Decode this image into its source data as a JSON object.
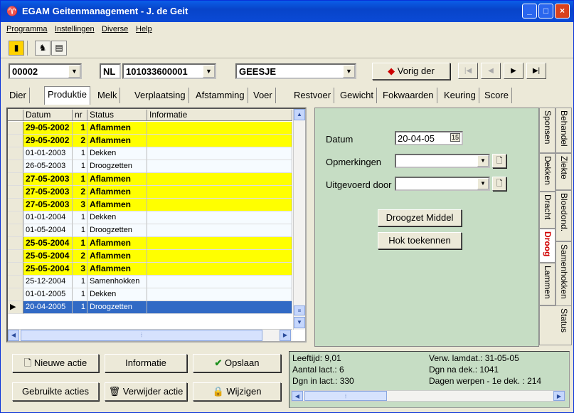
{
  "window": {
    "title": "EGAM Geitenmanagement - J. de Geit",
    "minimize": "_",
    "maximize": "□",
    "close": "×"
  },
  "menu": [
    "Programma",
    "Instellingen",
    "Diverse",
    "Help"
  ],
  "toolbar": {
    "exit_icon": "door-icon",
    "goat_icon": "goat-icon",
    "note_icon": "notepad-icon"
  },
  "selectors": {
    "number": "00002",
    "country": "NL",
    "id": "101033600001",
    "name": "GEESJE"
  },
  "nav": {
    "prev_label": "Vorig der",
    "first": "|◀",
    "prev": "◀",
    "next": "▶",
    "last": "▶|"
  },
  "tabs": [
    "Dier",
    "Produktie",
    "Melk",
    "Verplaatsing",
    "Afstamming",
    "Voer",
    "Restvoer",
    "Gewicht",
    "Fokwaarden",
    "Keuring",
    "Score"
  ],
  "grid": {
    "headers": [
      "Datum",
      "nr",
      "Status",
      "Informatie"
    ],
    "rows": [
      {
        "datum": "29-05-2002",
        "nr": "1",
        "status": "Aflammen",
        "info": "",
        "style": "yel"
      },
      {
        "datum": "29-05-2002",
        "nr": "2",
        "status": "Aflammen",
        "info": "",
        "style": "yel"
      },
      {
        "datum": "01-01-2003",
        "nr": "1",
        "status": "Dekken",
        "info": "",
        "style": "wht"
      },
      {
        "datum": "26-05-2003",
        "nr": "1",
        "status": "Droogzetten",
        "info": "",
        "style": "wht"
      },
      {
        "datum": "27-05-2003",
        "nr": "1",
        "status": "Aflammen",
        "info": "",
        "style": "yel"
      },
      {
        "datum": "27-05-2003",
        "nr": "2",
        "status": "Aflammen",
        "info": "",
        "style": "yel"
      },
      {
        "datum": "27-05-2003",
        "nr": "3",
        "status": "Aflammen",
        "info": "",
        "style": "yel"
      },
      {
        "datum": "01-01-2004",
        "nr": "1",
        "status": "Dekken",
        "info": "",
        "style": "wht"
      },
      {
        "datum": "01-05-2004",
        "nr": "1",
        "status": "Droogzetten",
        "info": "",
        "style": "wht"
      },
      {
        "datum": "25-05-2004",
        "nr": "1",
        "status": "Aflammen",
        "info": "",
        "style": "yel"
      },
      {
        "datum": "25-05-2004",
        "nr": "2",
        "status": "Aflammen",
        "info": "",
        "style": "yel"
      },
      {
        "datum": "25-05-2004",
        "nr": "3",
        "status": "Aflammen",
        "info": "",
        "style": "yel"
      },
      {
        "datum": "25-12-2004",
        "nr": "1",
        "status": "Samenhokken",
        "info": "",
        "style": "wht"
      },
      {
        "datum": "01-01-2005",
        "nr": "1",
        "status": "Dekken",
        "info": "",
        "style": "wht"
      },
      {
        "datum": "20-04-2005",
        "nr": "1",
        "status": "Droogzetten",
        "info": "",
        "style": "sel"
      }
    ]
  },
  "form": {
    "datum_label": "Datum",
    "datum_value": "20-04-05",
    "cal_icon": "15",
    "opmerkingen_label": "Opmerkingen",
    "uitgevoerd_label": "Uitgevoerd door",
    "droogzet_button": "Droogzet Middel",
    "hok_button": "Hok toekennen"
  },
  "side_tabs_right": [
    "Behandel",
    "Ziekte",
    "Bloedond.",
    "Samenhokken",
    "Status"
  ],
  "side_tabs_left": [
    "Sponsen",
    "Dekken",
    "Dracht",
    "Droog",
    "Lammen"
  ],
  "buttons": {
    "nieuwe": "Nieuwe actie",
    "informatie": "Informatie",
    "opslaan": "Opslaan",
    "gebruikte": "Gebruikte acties",
    "verwijder": "Verwijder actie",
    "wijzigen": "Wijzigen"
  },
  "info": {
    "leeftijd": "Leeftijd: 9,01",
    "aantal": "Aantal lact.: 6",
    "dgn_lact": "Dgn in lact.: 330",
    "verw": "Verw. lamdat.: 31-05-05",
    "dgn_dek": "Dgn na dek.: 1041",
    "dagen_werpen": "Dagen werpen - 1e dek. : 214"
  },
  "colors": {
    "yellow_row": "#ffff00",
    "selected_row": "#316ac5",
    "panel_bg": "#c6ddc4",
    "active_side_tab": "#d00000"
  }
}
